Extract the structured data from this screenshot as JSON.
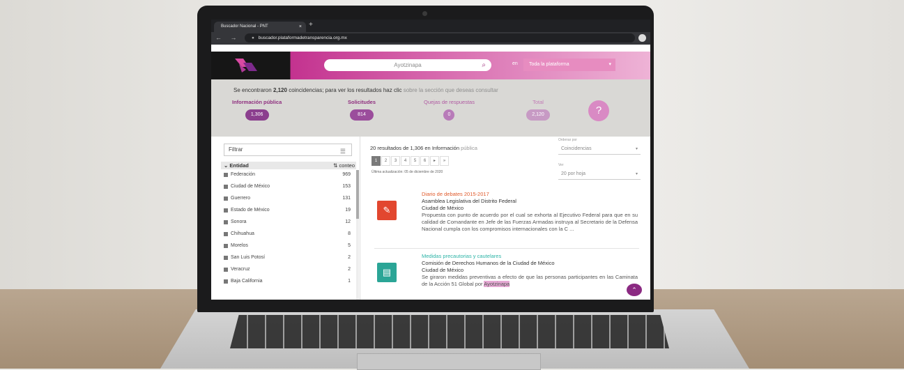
{
  "browser": {
    "tab_title": "Buscador Nacional - PNT",
    "tab_close": "×",
    "new_tab": "+",
    "nav_glyphs": "← → C",
    "lock": "🔒",
    "url": "buscador.plataformadetransparencia.org.mx"
  },
  "header": {
    "search_value": "Ayotzinapa",
    "search_icon": "search-icon",
    "scope_prefix": "en",
    "scope_value": "Toda la plataforma"
  },
  "summary": {
    "text_before": "Se encontraron ",
    "count": "2,120",
    "text_after": " coincidencias; para ver los resultados haz clic ",
    "text_muted": "sobre la sección que deseas consultar",
    "categories": [
      {
        "label": "Información pública",
        "count": "1,306"
      },
      {
        "label": "Solicitudes",
        "count": "814"
      },
      {
        "label": "Quejas de respuestas",
        "count": "0"
      },
      {
        "label": "Total",
        "count": "2,120"
      }
    ],
    "help": "?"
  },
  "filters": {
    "filter_placeholder": "Filtrar",
    "section_title": "Entidad",
    "count_header": "conteo",
    "entities": [
      {
        "name": "Federación",
        "count": "969"
      },
      {
        "name": "Ciudad de México",
        "count": "153"
      },
      {
        "name": "Guerrero",
        "count": "131"
      },
      {
        "name": "Estado de México",
        "count": "19"
      },
      {
        "name": "Sonora",
        "count": "12"
      },
      {
        "name": "Chihuahua",
        "count": "8"
      },
      {
        "name": "Morelos",
        "count": "5"
      },
      {
        "name": "San Luis Potosí",
        "count": "2"
      },
      {
        "name": "Veracruz",
        "count": "2"
      },
      {
        "name": "Baja California",
        "count": "1"
      }
    ]
  },
  "results": {
    "count_text": "20 resultados de 1,306 en Información ",
    "count_muted": "pública",
    "pages": [
      "1",
      "2",
      "3",
      "4",
      "5",
      "6",
      "▸",
      "»"
    ],
    "active_page": "1",
    "updated": "Última actualización: 05 de diciembre de 2020",
    "sort_label": "Ordenar por",
    "sort_value": "Coincidencias",
    "view_label": "Ver",
    "view_value": "20 por hoja",
    "items": [
      {
        "title": "Diario de debates 2015-2017",
        "title_color": "#e05a2b",
        "org": "Asamblea Legislativa del Distrito Federal",
        "location": "Ciudad de México",
        "description": "Propuesta con punto de acuerdo por el cual se exhorta al Ejecutivo Federal para que en su calidad de Comandante en Jefe de las Fuerzas Armadas instruya al Secretario de la Defensa Nacional cumpla con los compromisos internacionales con la C ...",
        "icon": "document-icon",
        "tile_color": "#e2472f"
      },
      {
        "title": "Medidas precautorias y cautelares",
        "title_color": "#2bb3a6",
        "org": "Comisión de Derechos Humanos de la Ciudad de México",
        "location": "Ciudad de México",
        "description": "Se giraron medidas preventivas a efecto de que las personas participantes en las Caminata de la Acción 51 Global por ",
        "highlight": "Ayotzinapa",
        "icon": "file-search-icon",
        "tile_color": "#2ba596"
      }
    ]
  },
  "scroll_top": "⌃"
}
